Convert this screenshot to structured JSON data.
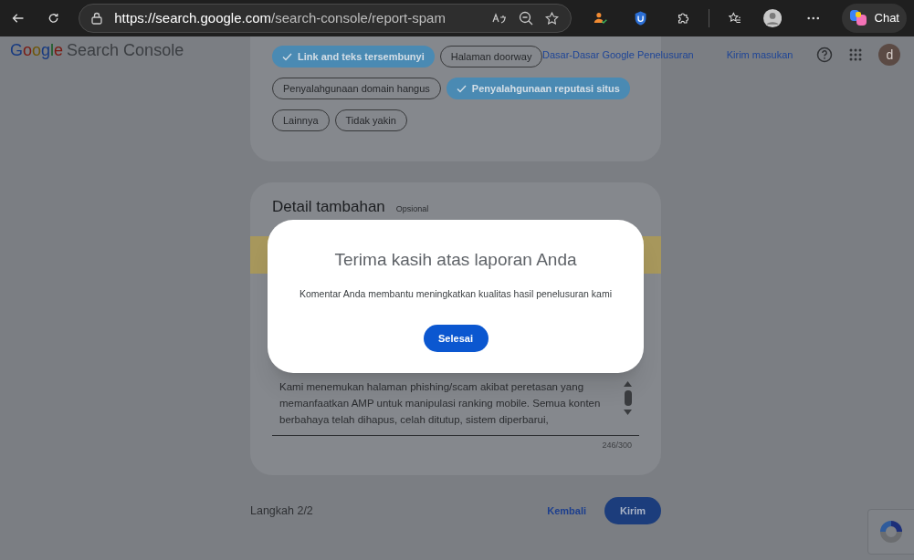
{
  "browser": {
    "url_host": "https://search.google.com",
    "url_path": "/search-console/report-spam",
    "chat_label": "Chat"
  },
  "header": {
    "logo": "Google",
    "product": "Search Console",
    "links": [
      "Dasar-Dasar Google Penelusuran",
      "Kirim masukan"
    ],
    "avatar": "d"
  },
  "chips": [
    {
      "label": "Link and teks tersembunyi",
      "selected": true
    },
    {
      "label": "Halaman doorway",
      "selected": false
    },
    {
      "label": "Penyalahgunaan domain hangus",
      "selected": false
    },
    {
      "label": "Penyalahgunaan reputasi situs",
      "selected": true
    },
    {
      "label": "Lainnya",
      "selected": false
    },
    {
      "label": "Tidak yakin",
      "selected": false
    }
  ],
  "details": {
    "title": "Detail tambahan",
    "optional": "Opsional",
    "text": "Kami menemukan halaman phishing/scam akibat peretasan yang memanfaatkan AMP untuk manipulasi ranking mobile. Semua konten berbahaya telah dihapus, celah ditutup, sistem diperbarui,",
    "counter": "246/300"
  },
  "footer": {
    "step": "Langkah 2/2",
    "back": "Kembali",
    "submit": "Kirim"
  },
  "dialog": {
    "title": "Terima kasih atas laporan Anda",
    "message": "Komentar Anda membantu meningkatkan kualitas hasil penelusuran kami",
    "button": "Selesai"
  }
}
